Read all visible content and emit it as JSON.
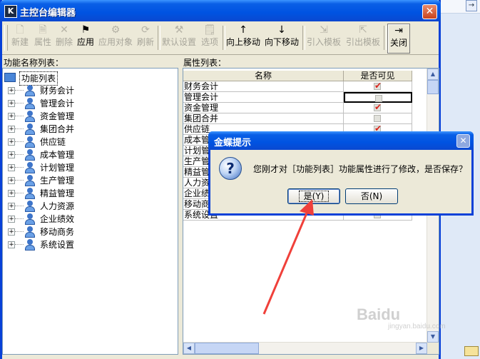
{
  "window": {
    "title": "主控台编辑器",
    "app_icon_letter": "K"
  },
  "toolbar": {
    "buttons": [
      {
        "label": "新建",
        "icon": "new-doc-icon",
        "glyph": "🗋",
        "enabled": false
      },
      {
        "label": "属性",
        "icon": "properties-icon",
        "glyph": "🗎",
        "enabled": false
      },
      {
        "label": "删除",
        "icon": "delete-icon",
        "glyph": "✕",
        "enabled": false
      },
      {
        "label": "应用",
        "icon": "apply-icon",
        "glyph": "⚑",
        "enabled": true
      },
      {
        "label": "应用对象",
        "icon": "apply-object-icon",
        "glyph": "⚙",
        "enabled": false
      },
      {
        "label": "刷新",
        "icon": "refresh-icon",
        "glyph": "⟳",
        "enabled": false
      },
      {
        "label": "默认设置",
        "icon": "default-settings-icon",
        "glyph": "⚒",
        "enabled": false
      },
      {
        "label": "选项",
        "icon": "options-icon",
        "glyph": "🗒",
        "enabled": false
      },
      {
        "label": "向上移动",
        "icon": "arrow-up-icon",
        "glyph": "↑",
        "enabled": true
      },
      {
        "label": "向下移动",
        "icon": "arrow-down-icon",
        "glyph": "↓",
        "enabled": true
      },
      {
        "label": "引入模板",
        "icon": "import-template-icon",
        "glyph": "⇲",
        "enabled": false
      },
      {
        "label": "引出模板",
        "icon": "export-template-icon",
        "glyph": "⇱",
        "enabled": false
      },
      {
        "label": "关闭",
        "icon": "exit-icon",
        "glyph": "⇥",
        "enabled": true
      }
    ]
  },
  "left_panel": {
    "label": "功能名称列表：",
    "root": "功能列表",
    "items": [
      "财务会计",
      "管理会计",
      "资金管理",
      "集团合并",
      "供应链",
      "成本管理",
      "计划管理",
      "生产管理",
      "精益管理",
      "人力资源",
      "企业绩效",
      "移动商务",
      "系统设置"
    ]
  },
  "right_panel": {
    "label": "属性列表：",
    "columns": [
      "名称",
      "是否可见"
    ],
    "rows": [
      {
        "name": "财务会计",
        "visible": true
      },
      {
        "name": "管理会计",
        "visible": false,
        "focused": true
      },
      {
        "name": "资金管理",
        "visible": true
      },
      {
        "name": "集团合并",
        "visible": false
      },
      {
        "name": "供应链",
        "visible": true
      },
      {
        "name": "成本管",
        "visible": true
      },
      {
        "name": "计划管",
        "visible": true
      },
      {
        "name": "生产管",
        "visible": true
      },
      {
        "name": "精益管",
        "visible": true
      },
      {
        "name": "人力资",
        "visible": true
      },
      {
        "name": "企业绩",
        "visible": true
      },
      {
        "name": "移动商",
        "visible": true
      },
      {
        "name": "系统设置",
        "visible": false
      }
    ]
  },
  "dialog": {
    "title": "金蝶提示",
    "message": "您刚才对［功能列表］功能属性进行了修改，是否保存？",
    "yes_label": "是(Y)",
    "no_label": "否(N)"
  },
  "watermark": {
    "text": "Baidu",
    "sub": "jingyan.baidu.com"
  },
  "colors": {
    "title_blue": "#0053e1",
    "check_red": "#d8241c",
    "annotation_arrow": "#f0403a"
  }
}
